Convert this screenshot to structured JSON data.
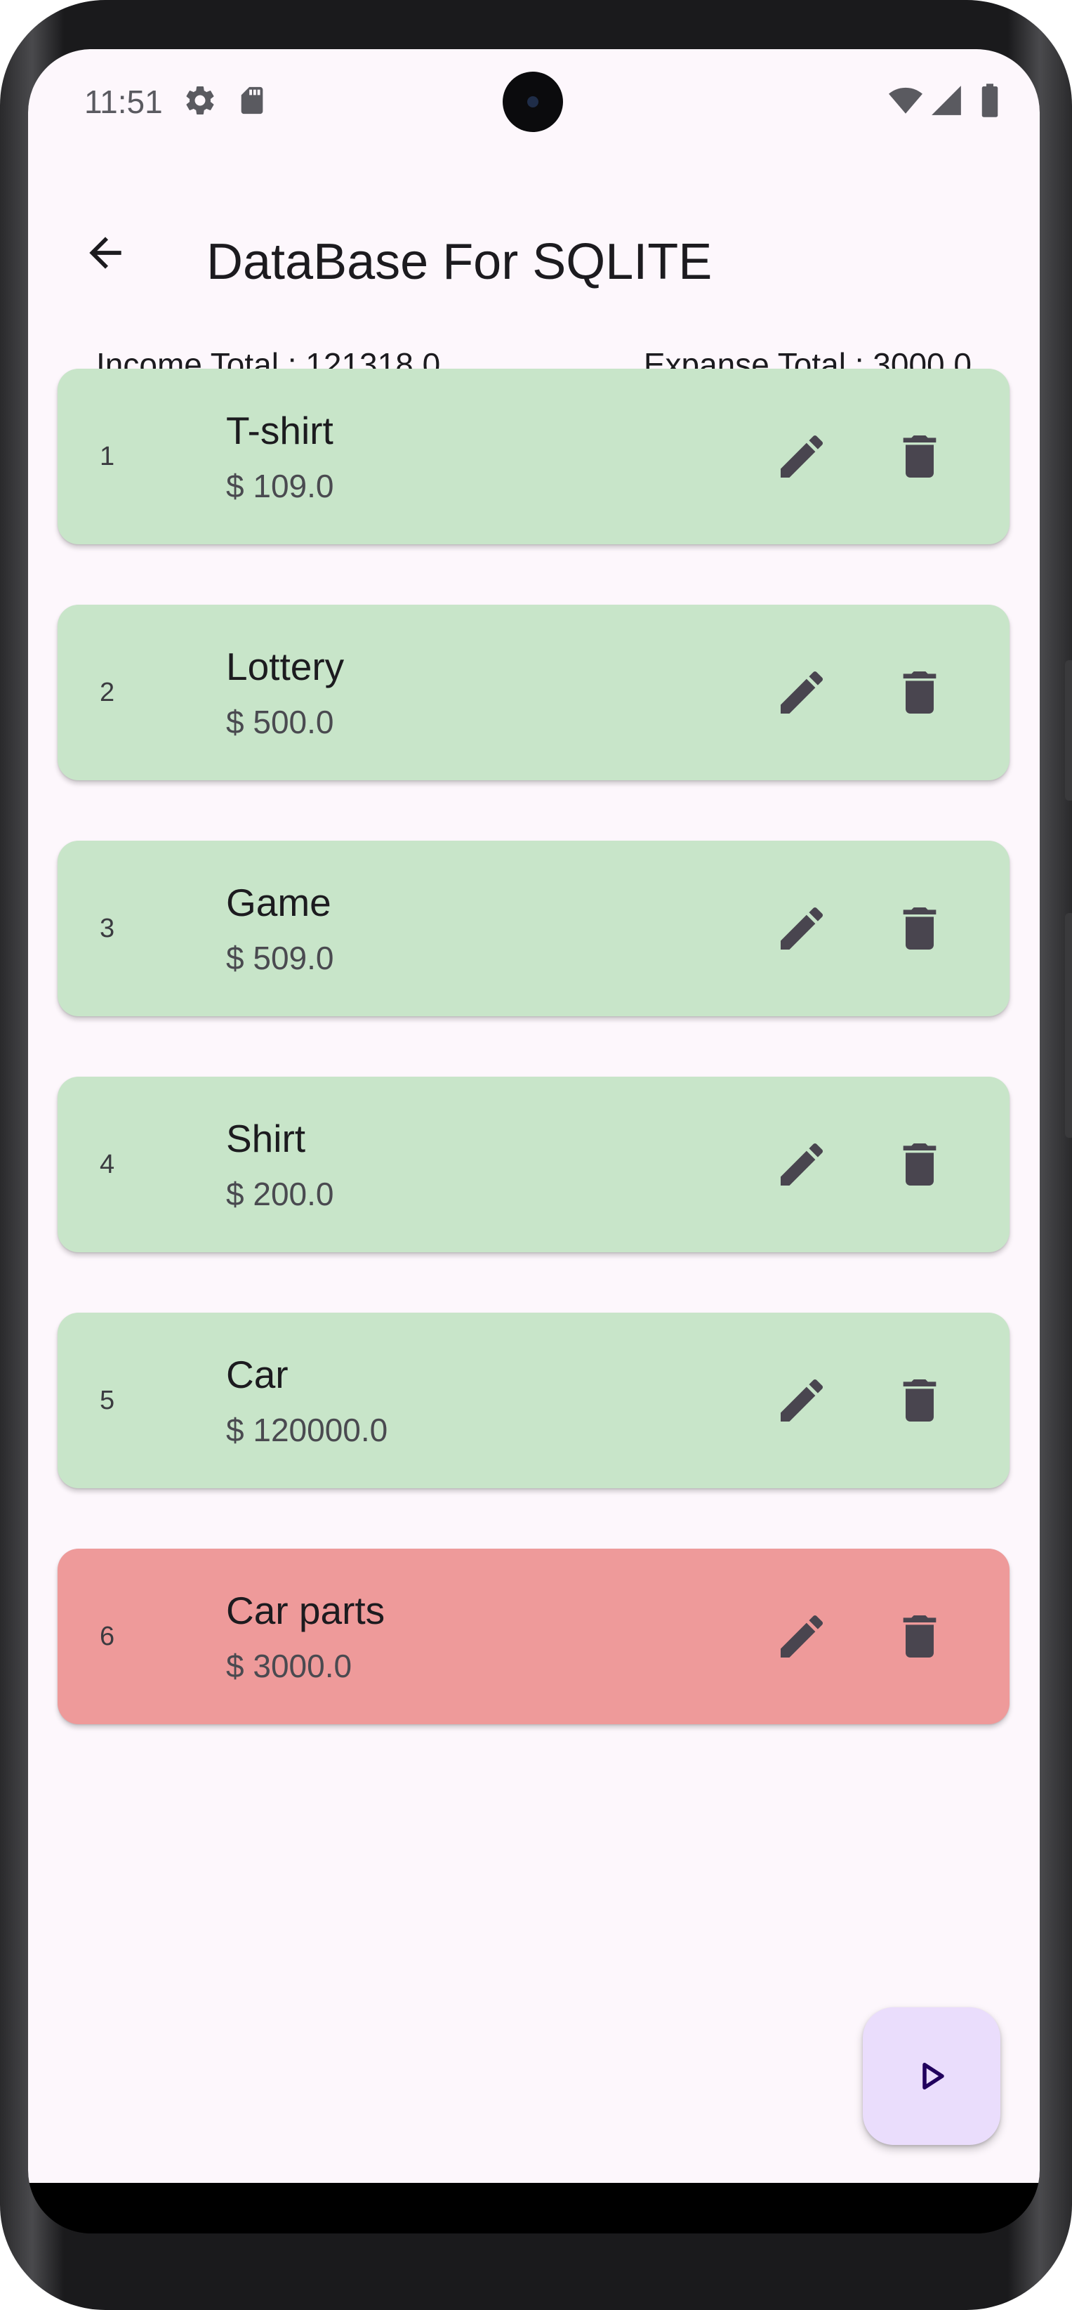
{
  "status_bar": {
    "time": "11:51",
    "icons": [
      "settings-icon",
      "sd-card-icon",
      "wifi-icon",
      "cellular-signal-icon",
      "battery-icon"
    ]
  },
  "app_bar": {
    "back_icon": "arrow-back-icon",
    "title": "DataBase For SQLITE"
  },
  "summary": {
    "income": "Income Total : 121318.0",
    "expense": "Expanse Total : 3000.0"
  },
  "colors": {
    "background": "#fdf7fc",
    "income_card": "#c8e5c9",
    "expense_card": "#ee9a9a",
    "icon": "#49454f",
    "fab": "#eaddfc",
    "fab_icon": "#21005d"
  },
  "transactions": [
    {
      "index": "1",
      "name": "T-shirt",
      "amount": "$ 109.0",
      "type": "income"
    },
    {
      "index": "2",
      "name": "Lottery",
      "amount": "$ 500.0",
      "type": "income"
    },
    {
      "index": "3",
      "name": "Game",
      "amount": "$ 509.0",
      "type": "income"
    },
    {
      "index": "4",
      "name": "Shirt",
      "amount": "$ 200.0",
      "type": "income"
    },
    {
      "index": "5",
      "name": "Car",
      "amount": "$ 120000.0",
      "type": "income"
    },
    {
      "index": "6",
      "name": "Car parts",
      "amount": "$ 3000.0",
      "type": "expense"
    }
  ],
  "row_actions": {
    "edit_icon": "edit-pencil-icon",
    "delete_icon": "delete-trash-icon"
  },
  "fab": {
    "icon": "play-arrow-icon"
  }
}
